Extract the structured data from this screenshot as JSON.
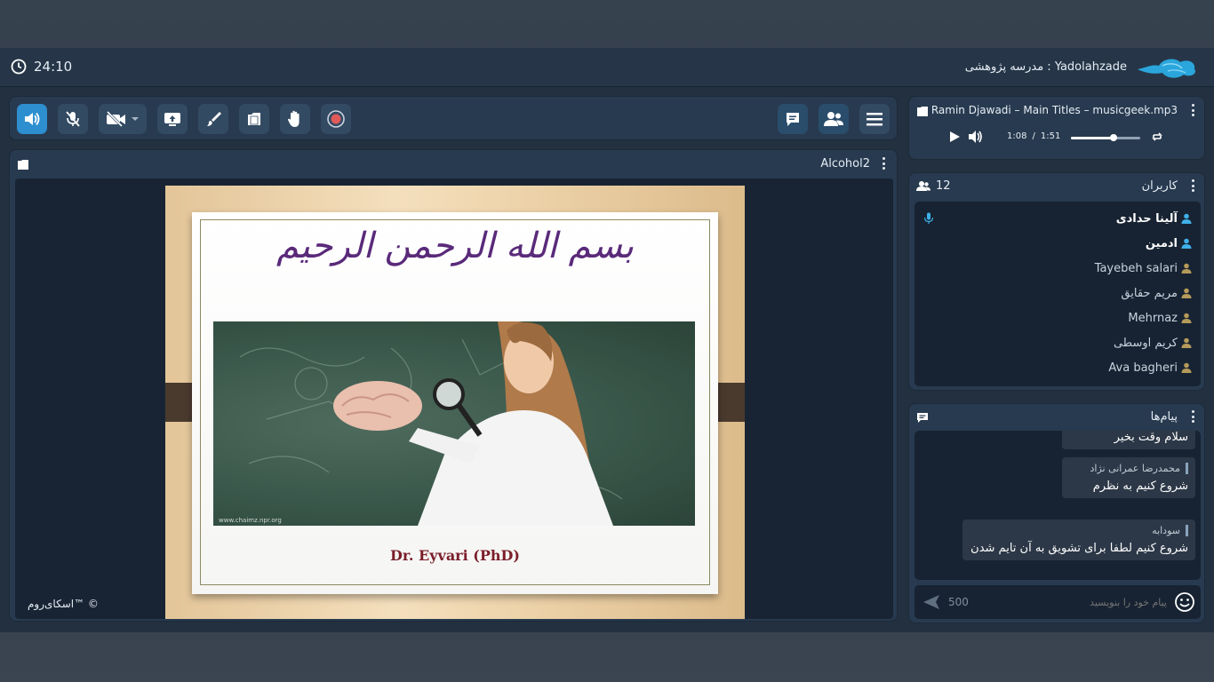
{
  "header": {
    "clock_time": "24:10",
    "school_label": "Yadolahzade : مدرسه پژوهشی"
  },
  "toolbar": {
    "left_buttons": [
      "speaker-icon",
      "mic-off-icon",
      "camera-off-icon",
      "share-screen-icon",
      "brush-icon",
      "files-icon",
      "raise-hand-icon",
      "record-icon"
    ],
    "right_buttons": [
      "chat-icon",
      "users-icon",
      "menu-icon"
    ]
  },
  "presentation": {
    "file_name": "Alcohol2",
    "slide_title": "بسم الله الرحمن الرحیم",
    "slide_author": "Dr. Eyvari  (PhD)",
    "copyright": "اسکای‌روم™ ©"
  },
  "music_player": {
    "track": "Ramin Djawadi – Main Titles – musicgeek.mp3",
    "current": "1:08",
    "separator": "/",
    "duration": "1:51",
    "progress_fraction": 0.62
  },
  "users_panel": {
    "title": "کاربران",
    "count": "12",
    "users": [
      {
        "name": "آلینا حدادی",
        "bold": true,
        "role": "admin",
        "mic": true
      },
      {
        "name": "ادمین",
        "bold": true,
        "role": "admin",
        "mic": false
      },
      {
        "name": "Tayebeh salari",
        "bold": false,
        "role": "user",
        "mic": false
      },
      {
        "name": "مریم حقایق",
        "bold": false,
        "role": "user",
        "mic": false
      },
      {
        "name": "Mehrnaz",
        "bold": false,
        "role": "user",
        "mic": false
      },
      {
        "name": "کریم اوسطی",
        "bold": false,
        "role": "user",
        "mic": false
      },
      {
        "name": "Ava bagheri",
        "bold": false,
        "role": "user",
        "mic": false
      }
    ]
  },
  "messages_panel": {
    "title": "پیام‌ها",
    "messages": [
      {
        "name": "",
        "text": "سلام وقت بخیر"
      },
      {
        "name": "محمدرضا عمرانی نژاد",
        "text": "شروع کنیم به نظرم"
      },
      {
        "name": "سودابه",
        "text": "شروع کنیم لطفا برای تشویق به آن تایم شدن"
      }
    ],
    "input_placeholder": "پیام خود را بنویسید",
    "char_limit": "500"
  },
  "colors": {
    "accent": "#2d8fcf",
    "admin_icon": "#3fb0e8",
    "user_icon": "#b59a5a",
    "record": "#e05a5a"
  }
}
